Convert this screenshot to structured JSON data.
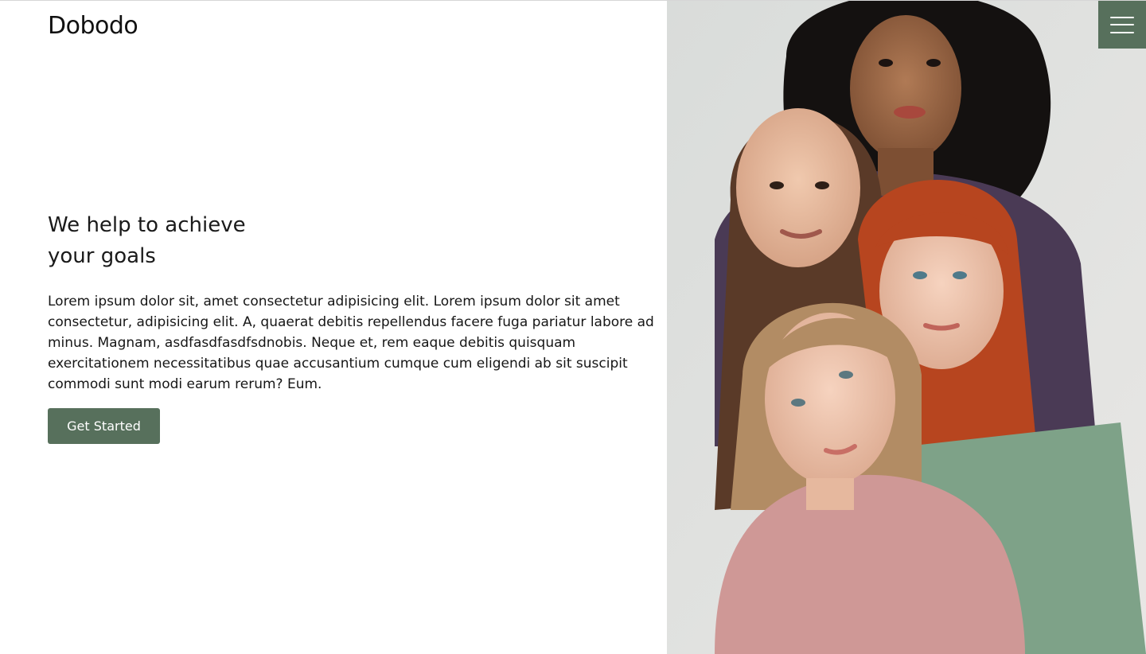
{
  "brand": {
    "name": "Dobodo"
  },
  "nav": {
    "menu_icon": "hamburger-menu-icon"
  },
  "hero": {
    "headline_line1": "We help to achieve",
    "headline_line2": "your goals",
    "body": "Lorem ipsum dolor sit, amet consectetur adipisicing elit. Lorem ipsum dolor sit amet consectetur, adipisicing elit. A, quaerat debitis repellendus facere fuga pariatur labore ad minus. Magnam, asdfasdfasdfsdnobis. Neque et, rem eaque debitis quisquam exercitationem necessitatibus quae accusantium cumque cum eligendi ab sit suscipit commodi sunt modi earum rerum? Eum.",
    "cta_label": "Get Started",
    "image_subject": "group photo of four young women"
  },
  "colors": {
    "accent": "#57705c",
    "text": "#161616",
    "background": "#ffffff",
    "photo_backdrop": "#dfe0de"
  }
}
